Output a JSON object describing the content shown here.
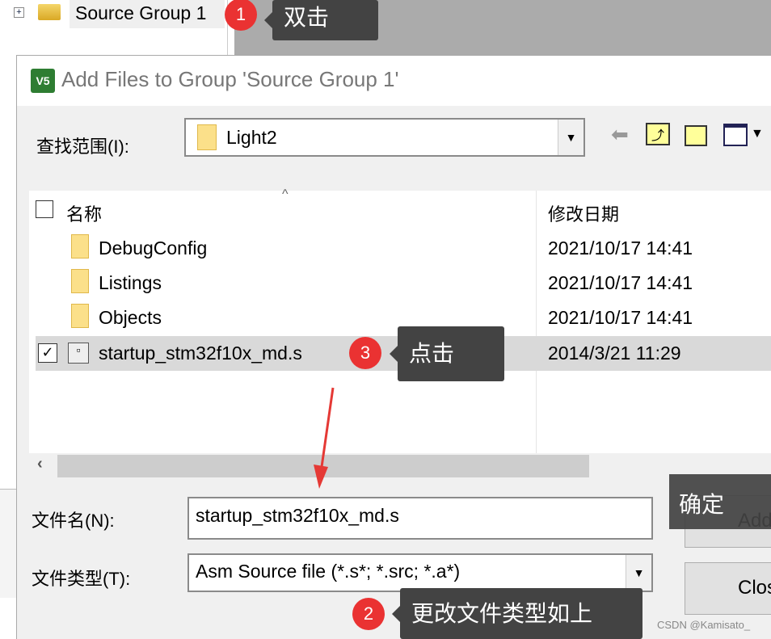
{
  "tree": {
    "expander": "+",
    "item": "Source Group 1"
  },
  "annotations": [
    {
      "num": "1",
      "text": "双击"
    },
    {
      "num": "3",
      "text": "点击"
    },
    {
      "num": "2",
      "text": "更改文件类型如上"
    },
    {
      "text": "确定"
    }
  ],
  "dialog": {
    "title": "Add Files to Group 'Source Group 1'",
    "app_icon": "V5",
    "look_in_label": "查找范围(I):",
    "look_in_value": "Light2",
    "toolbar": [
      "back-arrow-icon",
      "up-folder-icon",
      "new-folder-icon",
      "view-menu-icon"
    ],
    "columns": [
      "名称",
      "修改日期"
    ],
    "files": [
      {
        "name": "DebugConfig",
        "date": "2021/10/17 14:41",
        "type": "folder"
      },
      {
        "name": "Listings",
        "date": "2021/10/17 14:41",
        "type": "folder"
      },
      {
        "name": "Objects",
        "date": "2021/10/17 14:41",
        "type": "folder"
      },
      {
        "name": "startup_stm32f10x_md.s",
        "date": "2014/3/21 11:29",
        "type": "asm-file",
        "selected": true
      }
    ],
    "filename_label": "文件名(N):",
    "filename_value": "startup_stm32f10x_md.s",
    "filetype_label": "文件类型(T):",
    "filetype_value": "Asm Source file (*.s*; *.src; *.a*)",
    "add_button": "Add",
    "close_button": "Close"
  },
  "watermark": "CSDN @Kamisato_",
  "colors": {
    "badge": "#ea3232",
    "callout": "#434343",
    "selected_row": "#d9d9d9",
    "arrow": "#e53935"
  }
}
